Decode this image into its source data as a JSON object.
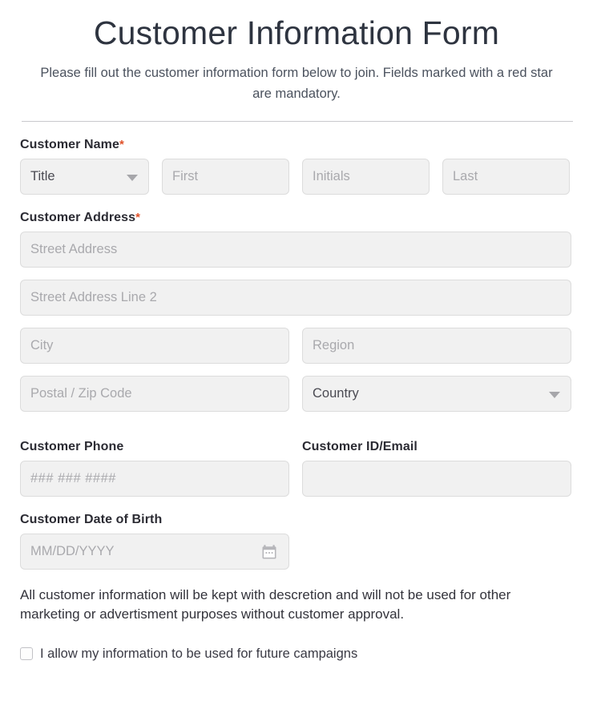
{
  "header": {
    "title": "Customer Information Form",
    "subtitle": "Please fill out the customer information form below to join. Fields marked with a red star are mandatory.",
    "required_marker": "*"
  },
  "colors": {
    "required_star": "#e0522a",
    "heading_text": "#2e3440",
    "field_background": "#f1f1f1",
    "field_border": "#dcdcdc",
    "placeholder_text": "#a9a9ad"
  },
  "sections": {
    "name": {
      "label": "Customer Name",
      "required": true,
      "title_select_value": "Title",
      "first_placeholder": "First",
      "initials_placeholder": "Initials",
      "last_placeholder": "Last"
    },
    "address": {
      "label": "Customer Address",
      "required": true,
      "street_placeholder": "Street Address",
      "street2_placeholder": "Street Address Line 2",
      "city_placeholder": "City",
      "region_placeholder": "Region",
      "postal_placeholder": "Postal / Zip Code",
      "country_select_value": "Country"
    },
    "phone": {
      "label": "Customer Phone",
      "placeholder": "### ### ####"
    },
    "email": {
      "label": "Customer ID/Email",
      "placeholder": ""
    },
    "dob": {
      "label": "Customer Date of Birth",
      "placeholder": "MM/DD/YYYY",
      "icon": "calendar-icon"
    }
  },
  "disclaimer": "All customer information will be kept with descretion and will not be used for other marketing or advertisment purposes without customer approval.",
  "consent": {
    "label": "I allow my information to be used for future campaigns",
    "checked": false
  },
  "icons": {
    "title_caret": "chevron-down-icon",
    "country_caret": "chevron-down-icon"
  }
}
